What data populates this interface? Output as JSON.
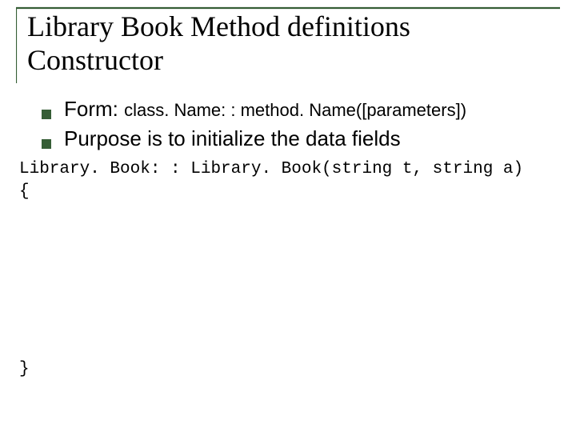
{
  "title": {
    "line1": "Library Book Method definitions",
    "line2": "Constructor"
  },
  "bullets": [
    {
      "label": "Form: ",
      "detail": "class. Name: : method. Name([parameters])"
    },
    {
      "label": "Purpose is to initialize the data fields",
      "detail": ""
    }
  ],
  "code": {
    "line1": "Library. Book: : Library. Book(string t, string a)",
    "line2": "{",
    "close": "}"
  },
  "accent_color": "#365e36"
}
